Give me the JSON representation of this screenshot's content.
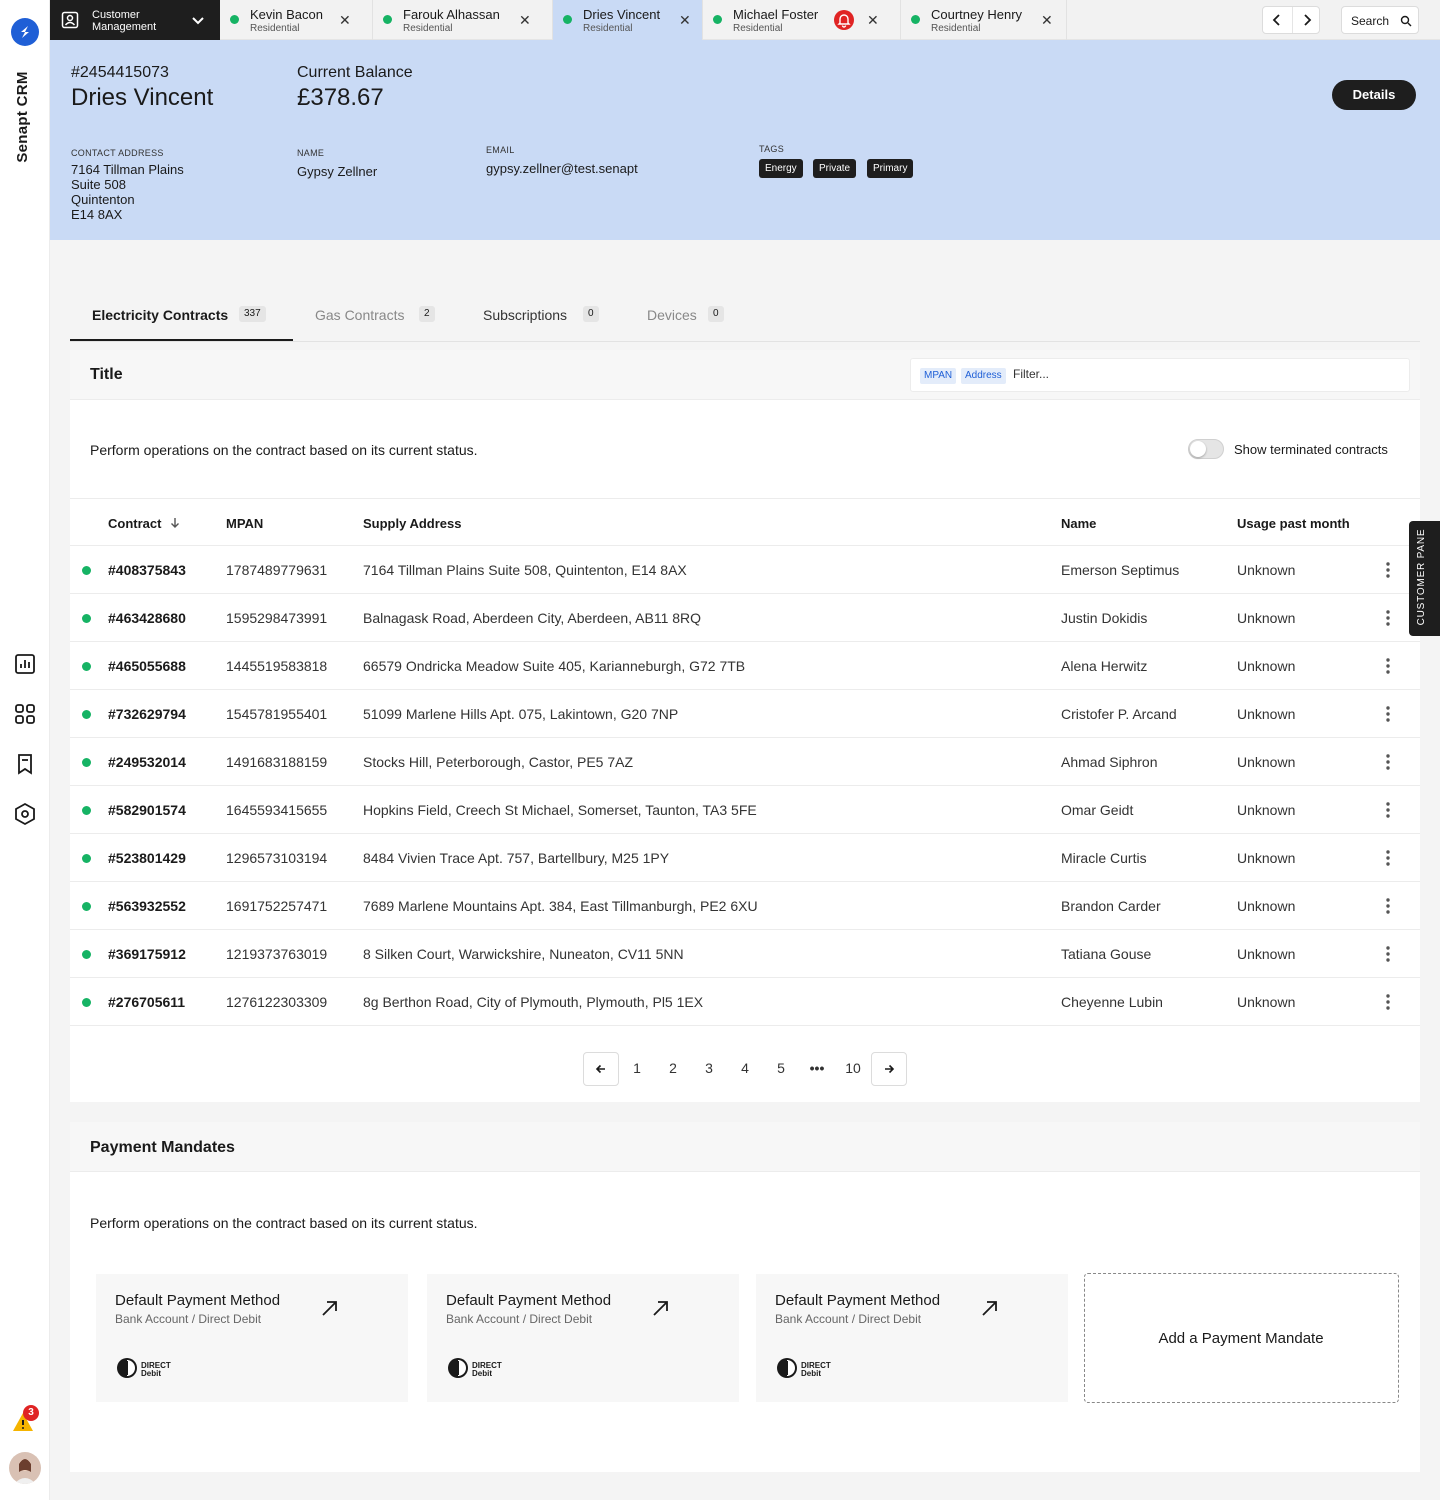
{
  "app": {
    "brand": "Senapt CRM",
    "module_label": "Customer Management"
  },
  "colors": {
    "accent": "#1f5fd6",
    "header_bg": "#c9daf5",
    "status_active": "#16b364",
    "alert": "#e02424",
    "dark": "#1e1e1e"
  },
  "customer_tabs": [
    {
      "name": "Kevin Bacon",
      "type": "Residential"
    },
    {
      "name": "Farouk Alhassan",
      "type": "Residential"
    },
    {
      "name": "Dries Vincent",
      "type": "Residential"
    },
    {
      "name": "Michael Foster",
      "type": "Residential"
    },
    {
      "name": "Courtney Henry",
      "type": "Residential"
    }
  ],
  "topbar": {
    "search_label": "Search"
  },
  "customer": {
    "id": "#2454415073",
    "name": "Dries Vincent",
    "balance_label": "Current Balance",
    "balance": "£378.67",
    "details_label": "Details",
    "address_label": "CONTACT ADDRESS",
    "address_lines": [
      "7164 Tillman Plains",
      "Suite 508",
      "Quintenton",
      "E14 8AX"
    ],
    "name_label": "NAME",
    "contact_name": "Gypsy Zellner",
    "email_label": "EMAIL",
    "email": "gypsy.zellner@test.senapt",
    "tags_label": "TAGS",
    "tags": [
      "Energy",
      "Private",
      "Primary"
    ]
  },
  "section_tabs": [
    {
      "label": "Electricity Contracts",
      "count": "337"
    },
    {
      "label": "Gas Contracts",
      "count": "2"
    },
    {
      "label": "Subscriptions",
      "count": "0"
    },
    {
      "label": "Devices",
      "count": "0"
    }
  ],
  "contracts": {
    "title": "Title",
    "filter_chips": [
      "MPAN",
      "Address"
    ],
    "filter_placeholder": "Filter...",
    "description": "Perform operations on the contract based on its current status.",
    "toggle_label": "Show terminated contracts",
    "toggle_on": false,
    "columns": [
      "Contract",
      "MPAN",
      "Supply Address",
      "Name",
      "Usage past month"
    ],
    "rows": [
      {
        "id": "#408375843",
        "mpan": "1787489779631",
        "address": "7164 Tillman Plains Suite 508, Quintenton, E14 8AX",
        "name": "Emerson Septimus",
        "usage": "Unknown"
      },
      {
        "id": "#463428680",
        "mpan": "1595298473991",
        "address": "Balnagask Road, Aberdeen City, Aberdeen, AB11 8RQ",
        "name": "Justin Dokidis",
        "usage": "Unknown"
      },
      {
        "id": "#465055688",
        "mpan": "1445519583818",
        "address": "66579 Ondricka Meadow Suite 405, Karianneburgh, G72 7TB",
        "name": "Alena Herwitz",
        "usage": "Unknown"
      },
      {
        "id": "#732629794",
        "mpan": "1545781955401",
        "address": "51099 Marlene Hills Apt. 075, Lakintown, G20 7NP",
        "name": "Cristofer P. Arcand",
        "usage": "Unknown"
      },
      {
        "id": "#249532014",
        "mpan": "1491683188159",
        "address": "Stocks Hill, Peterborough, Castor, PE5 7AZ",
        "name": "Ahmad Siphron",
        "usage": "Unknown"
      },
      {
        "id": "#582901574",
        "mpan": "1645593415655",
        "address": "Hopkins Field, Creech St Michael, Somerset, Taunton, TA3 5FE",
        "name": "Omar Geidt",
        "usage": "Unknown"
      },
      {
        "id": "#523801429",
        "mpan": "1296573103194",
        "address": "8484 Vivien Trace Apt. 757, Bartellbury, M25 1PY",
        "name": "Miracle Curtis",
        "usage": "Unknown"
      },
      {
        "id": "#563932552",
        "mpan": "1691752257471",
        "address": "7689 Marlene Mountains  Apt. 384, East Tillmanburgh, PE2 6XU",
        "name": "Brandon Carder",
        "usage": "Unknown"
      },
      {
        "id": "#369175912",
        "mpan": "1219373763019",
        "address": "8 Silken Court, Warwickshire, Nuneaton, CV11 5NN",
        "name": "Tatiana Gouse",
        "usage": "Unknown"
      },
      {
        "id": "#276705611",
        "mpan": "1276122303309",
        "address": "8g Berthon Road, City of Plymouth, Plymouth, Pl5 1EX",
        "name": "Cheyenne Lubin",
        "usage": "Unknown"
      }
    ],
    "pagination": [
      "1",
      "2",
      "3",
      "4",
      "5",
      "•••",
      "10"
    ]
  },
  "mandates": {
    "title": "Payment Mandates",
    "description": "Perform operations on the contract based on its current status.",
    "items": [
      {
        "title": "Default Payment Method",
        "subtitle": "Bank Account / Direct Debit"
      },
      {
        "title": "Default Payment Method",
        "subtitle": "Bank Account / Direct Debit"
      },
      {
        "title": "Default Payment Method",
        "subtitle": "Bank Account / Direct Debit"
      }
    ],
    "add_label": "Add a Payment Mandate"
  },
  "side_pane": {
    "label": "CUSTOMER PANE"
  },
  "notifications": {
    "alert_count": "3"
  }
}
